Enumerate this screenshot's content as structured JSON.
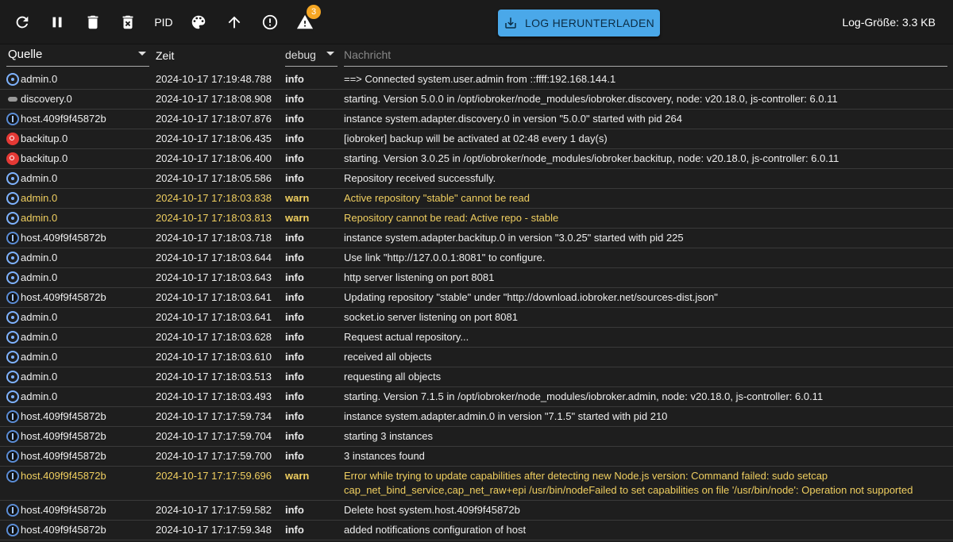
{
  "toolbar": {
    "pid_label": "PID",
    "warn_badge": "3",
    "download_label": "LOG HERUNTERLADEN",
    "log_size": "Log-Größe: 3.3 KB"
  },
  "filters": {
    "source": "Quelle",
    "time": "Zeit",
    "level": "debug",
    "message": "Nachricht"
  },
  "colors": {
    "warn": "#f0cf60",
    "accent": "#4aa8e9",
    "badge": "#f5a623"
  },
  "log": [
    {
      "src": "admin.0",
      "icon": "admin",
      "time": "2024-10-17 17:19:48.788",
      "level": "info",
      "msg": "==> Connected system.user.admin from ::ffff:192.168.144.1"
    },
    {
      "src": "discovery.0",
      "icon": "discovery",
      "time": "2024-10-17 17:18:08.908",
      "level": "info",
      "msg": "starting. Version 5.0.0 in /opt/iobroker/node_modules/iobroker.discovery, node: v20.18.0, js-controller: 6.0.11"
    },
    {
      "src": "host.409f9f45872b",
      "icon": "host",
      "time": "2024-10-17 17:18:07.876",
      "level": "info",
      "msg": "instance system.adapter.discovery.0 in version \"5.0.0\" started with pid 264"
    },
    {
      "src": "backitup.0",
      "icon": "backitup",
      "time": "2024-10-17 17:18:06.435",
      "level": "info",
      "msg": "[iobroker] backup will be activated at 02:48 every 1 day(s)"
    },
    {
      "src": "backitup.0",
      "icon": "backitup",
      "time": "2024-10-17 17:18:06.400",
      "level": "info",
      "msg": "starting. Version 3.0.25 in /opt/iobroker/node_modules/iobroker.backitup, node: v20.18.0, js-controller: 6.0.11"
    },
    {
      "src": "admin.0",
      "icon": "admin",
      "time": "2024-10-17 17:18:05.586",
      "level": "info",
      "msg": "Repository received successfully."
    },
    {
      "src": "admin.0",
      "icon": "admin",
      "time": "2024-10-17 17:18:03.838",
      "level": "warn",
      "msg": "Active repository \"stable\" cannot be read"
    },
    {
      "src": "admin.0",
      "icon": "admin",
      "time": "2024-10-17 17:18:03.813",
      "level": "warn",
      "msg": "Repository cannot be read: Active repo - stable"
    },
    {
      "src": "host.409f9f45872b",
      "icon": "host",
      "time": "2024-10-17 17:18:03.718",
      "level": "info",
      "msg": "instance system.adapter.backitup.0 in version \"3.0.25\" started with pid 225"
    },
    {
      "src": "admin.0",
      "icon": "admin",
      "time": "2024-10-17 17:18:03.644",
      "level": "info",
      "msg": "Use link \"http://127.0.0.1:8081\" to configure."
    },
    {
      "src": "admin.0",
      "icon": "admin",
      "time": "2024-10-17 17:18:03.643",
      "level": "info",
      "msg": "http server listening on port 8081"
    },
    {
      "src": "host.409f9f45872b",
      "icon": "host",
      "time": "2024-10-17 17:18:03.641",
      "level": "info",
      "msg": "Updating repository \"stable\" under \"http://download.iobroker.net/sources-dist.json\""
    },
    {
      "src": "admin.0",
      "icon": "admin",
      "time": "2024-10-17 17:18:03.641",
      "level": "info",
      "msg": "socket.io server listening on port 8081"
    },
    {
      "src": "admin.0",
      "icon": "admin",
      "time": "2024-10-17 17:18:03.628",
      "level": "info",
      "msg": "Request actual repository..."
    },
    {
      "src": "admin.0",
      "icon": "admin",
      "time": "2024-10-17 17:18:03.610",
      "level": "info",
      "msg": "received all objects"
    },
    {
      "src": "admin.0",
      "icon": "admin",
      "time": "2024-10-17 17:18:03.513",
      "level": "info",
      "msg": "requesting all objects"
    },
    {
      "src": "admin.0",
      "icon": "admin",
      "time": "2024-10-17 17:18:03.493",
      "level": "info",
      "msg": "starting. Version 7.1.5 in /opt/iobroker/node_modules/iobroker.admin, node: v20.18.0, js-controller: 6.0.11"
    },
    {
      "src": "host.409f9f45872b",
      "icon": "host",
      "time": "2024-10-17 17:17:59.734",
      "level": "info",
      "msg": "instance system.adapter.admin.0 in version \"7.1.5\" started with pid 210"
    },
    {
      "src": "host.409f9f45872b",
      "icon": "host",
      "time": "2024-10-17 17:17:59.704",
      "level": "info",
      "msg": "starting 3 instances"
    },
    {
      "src": "host.409f9f45872b",
      "icon": "host",
      "time": "2024-10-17 17:17:59.700",
      "level": "info",
      "msg": "3 instances found"
    },
    {
      "src": "host.409f9f45872b",
      "icon": "host",
      "time": "2024-10-17 17:17:59.696",
      "level": "warn",
      "msg": "Error while trying to update capabilities after detecting new Node.js version: Command failed: sudo setcap",
      "msg2": "cap_net_bind_service,cap_net_raw+epi /usr/bin/nodeFailed to set capabilities on file '/usr/bin/node': Operation not supported"
    },
    {
      "src": "host.409f9f45872b",
      "icon": "host",
      "time": "2024-10-17 17:17:59.582",
      "level": "info",
      "msg": "Delete host system.host.409f9f45872b"
    },
    {
      "src": "host.409f9f45872b",
      "icon": "host",
      "time": "2024-10-17 17:17:59.348",
      "level": "info",
      "msg": "added notifications configuration of host"
    }
  ]
}
